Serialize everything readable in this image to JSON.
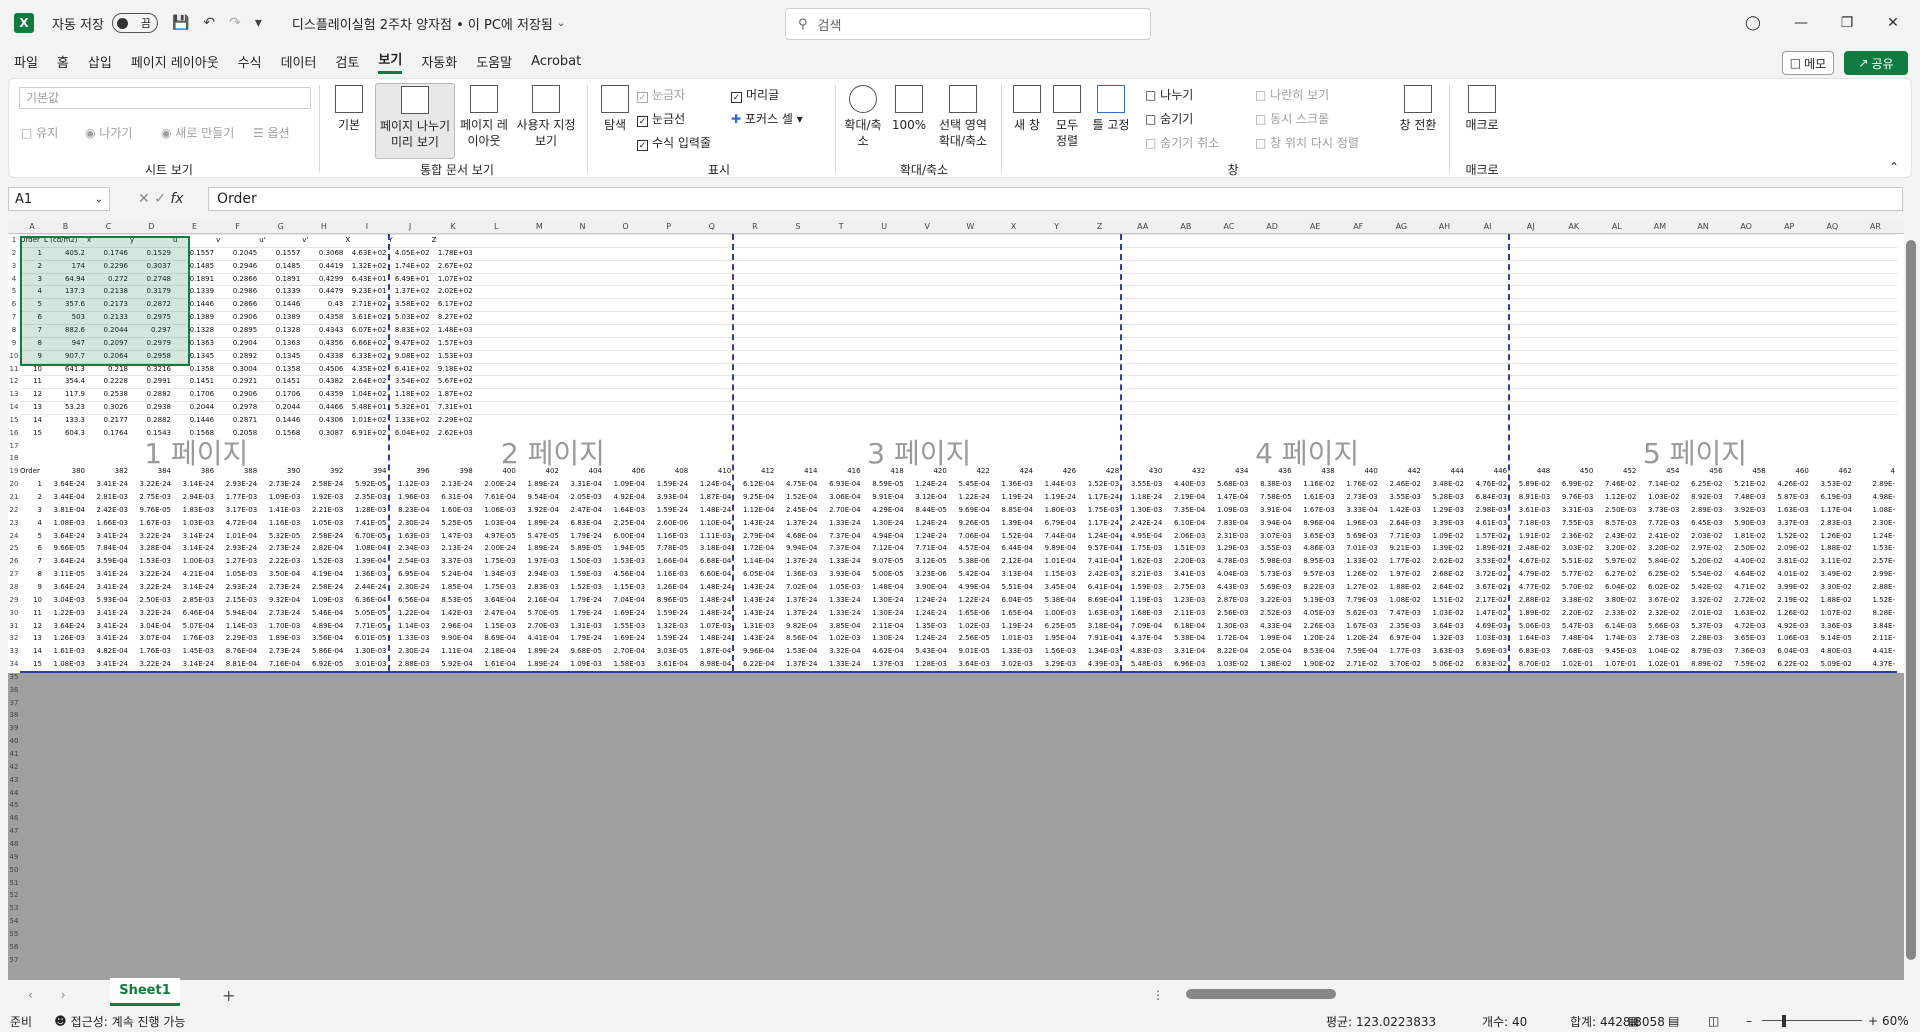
{
  "titlebar": {
    "autosave_label": "자동 저장",
    "autosave_state": "끔",
    "document_title": "디스플레이실험 2주차 양자점 • 이 PC에 저장됨",
    "search_placeholder": "검색"
  },
  "menu": [
    "파일",
    "홈",
    "삽입",
    "페이지 레이아웃",
    "수식",
    "데이터",
    "검토",
    "보기",
    "자동화",
    "도움말",
    "Acrobat"
  ],
  "menu_active": "보기",
  "memo_label": "메모",
  "share_label": "공유",
  "ribbon": {
    "sheet_view": {
      "label": "시트 보기",
      "default_box": "기본값",
      "keep": "유지",
      "exit": "나가기",
      "new": "새로 만들기",
      "options": "옵션"
    },
    "workbook_views": {
      "label": "통합 문서 보기",
      "normal": "기본",
      "page_break": "페이지 나누기 미리 보기",
      "page_layout": "페이지 레이아웃",
      "custom": "사용자 지정 보기"
    },
    "show": {
      "label": "표시",
      "navigation": "탐색",
      "ruler": "눈금자",
      "gridlines": "눈금선",
      "formula_bar": "수식 입력줄",
      "headings": "머리글",
      "focus_cell": "포커스 셀"
    },
    "zoom": {
      "label": "확대/축소",
      "zoom": "확대/축소",
      "hundred": "100%",
      "zoom_selection": "선택 영역 확대/축소"
    },
    "window": {
      "label": "창",
      "new_window": "새 창",
      "arrange_all": "모두 정렬",
      "freeze_panes": "틀 고정",
      "split": "나누기",
      "hide": "숨기기",
      "unhide": "숨기기 취소",
      "side_by_side": "나란히 보기",
      "sync_scroll": "동시 스크롤",
      "reset_position": "창 위치 다시 정렬",
      "switch_windows": "창 전환"
    },
    "macros": {
      "label": "매크로",
      "macros": "매크로"
    }
  },
  "formula_bar": {
    "name_box": "A1",
    "formula": "Order"
  },
  "grid": {
    "columns": [
      "A",
      "B",
      "C",
      "D",
      "E",
      "F",
      "G",
      "H",
      "I",
      "J",
      "K",
      "L",
      "M",
      "N",
      "O",
      "P",
      "Q",
      "R",
      "S",
      "T",
      "U",
      "V",
      "W",
      "X",
      "Y",
      "Z",
      "AA",
      "AB",
      "AC",
      "AD",
      "AE",
      "AF",
      "AG",
      "AH",
      "AI",
      "AJ",
      "AK",
      "AL",
      "AM",
      "AN",
      "AO",
      "AP",
      "AQ",
      "AR"
    ],
    "header_row": [
      "Order",
      "L (cd/m2)",
      "x",
      "y",
      "u",
      "v",
      "u'",
      "v'",
      "X",
      "Y",
      "Z"
    ],
    "data_rows": [
      [
        "1",
        "405.2",
        "0.1746",
        "0.1529",
        "0.1557",
        "0.2045",
        "0.1557",
        "0.3068",
        "4.63E+02",
        "4.05E+02",
        "1.78E+03"
      ],
      [
        "2",
        "174",
        "0.2296",
        "0.3037",
        "0.1485",
        "0.2946",
        "0.1485",
        "0.4419",
        "1.32E+02",
        "1.74E+02",
        "2.67E+02"
      ],
      [
        "3",
        "64.94",
        "0.272",
        "0.2748",
        "0.1891",
        "0.2866",
        "0.1891",
        "0.4299",
        "6.43E+01",
        "6.49E+01",
        "1.07E+02"
      ],
      [
        "4",
        "137.3",
        "0.2138",
        "0.3179",
        "0.1339",
        "0.2986",
        "0.1339",
        "0.4479",
        "9.23E+01",
        "1.37E+02",
        "2.02E+02"
      ],
      [
        "5",
        "357.6",
        "0.2173",
        "0.2872",
        "0.1446",
        "0.2866",
        "0.1446",
        "0.43",
        "2.71E+02",
        "3.58E+02",
        "6.17E+02"
      ],
      [
        "6",
        "503",
        "0.2133",
        "0.2975",
        "0.1389",
        "0.2906",
        "0.1389",
        "0.4358",
        "3.61E+02",
        "5.03E+02",
        "8.27E+02"
      ],
      [
        "7",
        "882.6",
        "0.2044",
        "0.297",
        "0.1328",
        "0.2895",
        "0.1328",
        "0.4343",
        "6.07E+02",
        "8.83E+02",
        "1.48E+03"
      ],
      [
        "8",
        "947",
        "0.2097",
        "0.2979",
        "0.1363",
        "0.2904",
        "0.1363",
        "0.4356",
        "6.66E+02",
        "9.47E+02",
        "1.57E+03"
      ],
      [
        "9",
        "907.7",
        "0.2064",
        "0.2958",
        "0.1345",
        "0.2892",
        "0.1345",
        "0.4338",
        "6.33E+02",
        "9.08E+02",
        "1.53E+03"
      ],
      [
        "10",
        "641.3",
        "0.218",
        "0.3216",
        "0.1358",
        "0.3004",
        "0.1358",
        "0.4506",
        "4.35E+02",
        "6.41E+02",
        "9.18E+02"
      ],
      [
        "11",
        "354.4",
        "0.2228",
        "0.2991",
        "0.1451",
        "0.2921",
        "0.1451",
        "0.4382",
        "2.64E+02",
        "3.54E+02",
        "5.67E+02"
      ],
      [
        "12",
        "117.9",
        "0.2538",
        "0.2882",
        "0.1706",
        "0.2906",
        "0.1706",
        "0.4359",
        "1.04E+02",
        "1.18E+02",
        "1.87E+02"
      ],
      [
        "13",
        "53.23",
        "0.3026",
        "0.2938",
        "0.2044",
        "0.2978",
        "0.2044",
        "0.4466",
        "5.48E+01",
        "5.32E+01",
        "7.31E+01"
      ],
      [
        "14",
        "133.3",
        "0.2177",
        "0.2882",
        "0.1446",
        "0.2871",
        "0.1446",
        "0.4306",
        "1.01E+02",
        "1.33E+02",
        "2.29E+02"
      ],
      [
        "15",
        "604.3",
        "0.1764",
        "0.1543",
        "0.1568",
        "0.2058",
        "0.1568",
        "0.3087",
        "6.91E+02",
        "6.04E+02",
        "2.62E+03"
      ]
    ],
    "spectrum_header_label": "Order",
    "wavelengths": [
      "380",
      "382",
      "384",
      "386",
      "388",
      "390",
      "392",
      "394",
      "396",
      "398",
      "400",
      "402",
      "404",
      "406",
      "408",
      "410",
      "412",
      "414",
      "416",
      "418",
      "420",
      "422",
      "424",
      "426",
      "428",
      "430",
      "432",
      "434",
      "436",
      "438",
      "440",
      "442",
      "444",
      "446",
      "448",
      "450",
      "452",
      "454",
      "456",
      "458",
      "460",
      "462",
      "4"
    ],
    "spectrum_rows": [
      [
        "1",
        "3.64E-24",
        "3.41E-24",
        "3.22E-24",
        "3.14E-24",
        "2.93E-24",
        "2.73E-24",
        "2.58E-24",
        "5.92E-05",
        "1.12E-03",
        "2.13E-24",
        "2.00E-24",
        "1.89E-24",
        "3.31E-04",
        "1.09E-04",
        "1.59E-24",
        "1.24E-04",
        "6.12E-04",
        "4.75E-04",
        "6.93E-04",
        "8.59E-05",
        "1.24E-24",
        "5.45E-04",
        "1.36E-03",
        "1.44E-03",
        "1.52E-03",
        "3.55E-03",
        "4.40E-03",
        "5.68E-03",
        "8.38E-03",
        "1.16E-02",
        "1.76E-02",
        "2.46E-02",
        "3.48E-02",
        "4.76E-02",
        "5.89E-02",
        "6.99E-02",
        "7.46E-02",
        "7.14E-02",
        "6.25E-02",
        "5.21E-02",
        "4.26E-02",
        "3.53E-02",
        "2.89E-"
      ],
      [
        "2",
        "3.44E-04",
        "2.81E-03",
        "2.75E-03",
        "2.94E-03",
        "1.77E-03",
        "1.09E-03",
        "1.92E-03",
        "2.35E-03",
        "1.96E-03",
        "6.31E-04",
        "7.61E-04",
        "9.54E-04",
        "2.05E-03",
        "4.92E-04",
        "3.93E-04",
        "1.87E-04",
        "9.25E-04",
        "1.52E-04",
        "3.06E-04",
        "9.91E-04",
        "3.12E-04",
        "1.22E-24",
        "1.19E-24",
        "1.19E-24",
        "1.17E-24",
        "1.18E-24",
        "2.19E-04",
        "1.47E-04",
        "7.58E-05",
        "1.61E-03",
        "2.73E-03",
        "3.55E-03",
        "5.28E-03",
        "6.84E-03",
        "8.91E-03",
        "9.76E-03",
        "1.12E-02",
        "1.03E-02",
        "8.92E-03",
        "7.48E-03",
        "5.87E-03",
        "6.19E-03",
        "4.98E-"
      ],
      [
        "3",
        "3.81E-04",
        "2.42E-03",
        "9.76E-05",
        "1.83E-03",
        "3.17E-03",
        "1.41E-03",
        "2.21E-03",
        "1.28E-03",
        "8.23E-04",
        "1.60E-03",
        "1.06E-03",
        "3.92E-04",
        "2.47E-04",
        "1.64E-03",
        "1.59E-24",
        "1.48E-24",
        "1.12E-04",
        "2.45E-04",
        "2.70E-04",
        "4.29E-04",
        "8.44E-05",
        "9.69E-04",
        "8.85E-04",
        "1.80E-03",
        "1.75E-03",
        "1.30E-03",
        "7.35E-04",
        "1.09E-03",
        "3.91E-04",
        "1.67E-03",
        "3.33E-04",
        "1.42E-03",
        "1.29E-03",
        "2.98E-03",
        "3.61E-03",
        "3.31E-03",
        "2.50E-03",
        "3.73E-03",
        "2.89E-03",
        "3.92E-03",
        "1.63E-03",
        "1.17E-04",
        "1.08E-"
      ],
      [
        "4",
        "1.08E-03",
        "1.66E-03",
        "1.67E-03",
        "1.03E-03",
        "4.72E-04",
        "1.16E-03",
        "1.05E-03",
        "7.41E-05",
        "2.30E-24",
        "5.25E-05",
        "1.03E-04",
        "1.89E-24",
        "6.83E-04",
        "2.25E-04",
        "2.60E-06",
        "1.10E-04",
        "1.43E-24",
        "1.37E-24",
        "1.33E-24",
        "1.30E-24",
        "1.24E-24",
        "9.26E-05",
        "1.39E-04",
        "6.79E-04",
        "1.17E-24",
        "2.42E-24",
        "6.10E-04",
        "7.83E-04",
        "3.94E-04",
        "8.96E-04",
        "1.96E-03",
        "2.64E-03",
        "3.39E-03",
        "4.61E-03",
        "7.18E-03",
        "7.55E-03",
        "8.57E-03",
        "7.72E-03",
        "6.45E-03",
        "5.90E-03",
        "3.37E-03",
        "2.83E-03",
        "2.30E-"
      ],
      [
        "5",
        "3.64E-24",
        "3.41E-24",
        "3.22E-24",
        "3.14E-24",
        "1.01E-04",
        "5.32E-05",
        "2.58E-24",
        "6.70E-05",
        "1.63E-03",
        "1.47E-03",
        "4.97E-05",
        "5.47E-05",
        "1.79E-24",
        "6.00E-04",
        "1.16E-03",
        "1.11E-03",
        "2.79E-04",
        "4.68E-04",
        "7.37E-04",
        "4.94E-04",
        "1.24E-24",
        "7.06E-04",
        "1.52E-04",
        "7.44E-04",
        "1.24E-04",
        "4.95E-04",
        "2.06E-03",
        "2.31E-03",
        "3.07E-03",
        "3.65E-03",
        "5.69E-03",
        "7.71E-03",
        "1.09E-02",
        "1.57E-02",
        "1.91E-02",
        "2.36E-02",
        "2.43E-02",
        "2.41E-02",
        "2.03E-02",
        "1.81E-02",
        "1.52E-02",
        "1.26E-02",
        "1.24E-"
      ],
      [
        "6",
        "9.66E-05",
        "7.84E-04",
        "3.28E-04",
        "3.14E-24",
        "2.93E-24",
        "2.73E-24",
        "2.82E-04",
        "1.08E-04",
        "2.34E-03",
        "2.13E-24",
        "2.00E-24",
        "1.89E-24",
        "5.89E-05",
        "1.94E-05",
        "7.78E-05",
        "3.18E-04",
        "1.72E-04",
        "9.94E-04",
        "7.37E-04",
        "7.12E-04",
        "7.71E-04",
        "4.57E-04",
        "6.44E-04",
        "9.89E-04",
        "9.57E-04",
        "1.75E-03",
        "1.51E-03",
        "1.29E-03",
        "3.55E-03",
        "4.86E-03",
        "7.01E-03",
        "9.21E-03",
        "1.39E-02",
        "1.89E-02",
        "2.48E-02",
        "3.03E-02",
        "3.20E-02",
        "3.20E-02",
        "2.97E-02",
        "2.50E-02",
        "2.09E-02",
        "1.88E-02",
        "1.53E-"
      ],
      [
        "7",
        "3.64E-24",
        "3.59E-04",
        "1.53E-03",
        "1.00E-03",
        "1.27E-03",
        "2.22E-03",
        "1.52E-03",
        "1.39E-04",
        "2.54E-03",
        "3.37E-03",
        "1.75E-03",
        "1.97E-03",
        "1.50E-03",
        "1.53E-03",
        "1.66E-04",
        "6.68E-04",
        "1.14E-04",
        "1.37E-24",
        "1.33E-24",
        "9.07E-05",
        "3.12E-05",
        "5.38E-06",
        "2.12E-04",
        "1.01E-04",
        "7.41E-04",
        "1.62E-03",
        "2.20E-03",
        "4.78E-03",
        "5.98E-03",
        "8.95E-03",
        "1.33E-02",
        "1.77E-02",
        "2.62E-02",
        "3.53E-02",
        "4.67E-02",
        "5.51E-02",
        "5.97E-02",
        "5.84E-02",
        "5.20E-02",
        "4.40E-02",
        "3.81E-02",
        "3.11E-02",
        "2.57E-"
      ],
      [
        "8",
        "3.11E-05",
        "3.41E-24",
        "3.22E-24",
        "4.21E-04",
        "1.05E-03",
        "3.50E-04",
        "4.19E-04",
        "1.36E-03",
        "6.95E-04",
        "5.24E-04",
        "1.34E-03",
        "2.94E-03",
        "1.59E-03",
        "4.56E-04",
        "1.16E-03",
        "6.60E-04",
        "6.05E-04",
        "1.36E-03",
        "3.93E-04",
        "5.00E-05",
        "3.23E-06",
        "5.42E-04",
        "3.13E-04",
        "1.15E-03",
        "2.42E-03",
        "3.21E-03",
        "3.41E-03",
        "4.04E-03",
        "5.73E-03",
        "9.57E-03",
        "1.26E-02",
        "1.97E-02",
        "2.68E-02",
        "3.72E-02",
        "4.79E-02",
        "5.77E-02",
        "6.27E-02",
        "6.25E-02",
        "5.54E-02",
        "4.64E-02",
        "4.01E-02",
        "3.49E-02",
        "2.99E-"
      ],
      [
        "9",
        "3.64E-24",
        "3.41E-24",
        "3.22E-24",
        "3.14E-24",
        "2.93E-24",
        "2.73E-24",
        "2.58E-24",
        "2.44E-24",
        "2.30E-24",
        "1.85E-04",
        "1.75E-03",
        "2.83E-03",
        "1.52E-03",
        "1.15E-03",
        "1.26E-04",
        "1.48E-24",
        "1.43E-24",
        "7.02E-04",
        "1.05E-03",
        "1.48E-04",
        "3.90E-04",
        "4.99E-04",
        "5.51E-04",
        "3.45E-04",
        "6.41E-04",
        "1.59E-03",
        "2.75E-03",
        "4.43E-03",
        "5.69E-03",
        "8.22E-03",
        "1.27E-02",
        "1.88E-02",
        "2.64E-02",
        "3.67E-02",
        "4.77E-02",
        "5.70E-02",
        "6.04E-02",
        "6.02E-02",
        "5.42E-02",
        "4.71E-02",
        "3.99E-02",
        "3.30E-02",
        "2.88E-"
      ],
      [
        "10",
        "3.04E-03",
        "5.93E-04",
        "2.50E-03",
        "2.85E-03",
        "2.15E-03",
        "9.32E-04",
        "1.09E-03",
        "6.36E-04",
        "6.56E-04",
        "8.53E-05",
        "3.64E-04",
        "2.16E-04",
        "1.79E-24",
        "7.04E-04",
        "8.96E-05",
        "1.48E-24",
        "1.43E-24",
        "1.37E-24",
        "1.33E-24",
        "1.30E-24",
        "1.24E-24",
        "1.22E-24",
        "6.04E-05",
        "5.38E-04",
        "8.69E-04",
        "1.19E-03",
        "1.23E-03",
        "2.87E-03",
        "3.22E-03",
        "5.19E-03",
        "7.79E-03",
        "1.08E-02",
        "1.51E-02",
        "2.17E-02",
        "2.88E-02",
        "3.38E-02",
        "3.80E-02",
        "3.67E-02",
        "3.32E-02",
        "2.72E-02",
        "2.19E-02",
        "1.88E-02",
        "1.52E-"
      ],
      [
        "11",
        "1.22E-03",
        "3.41E-24",
        "3.22E-24",
        "6.46E-04",
        "5.94E-04",
        "2.73E-24",
        "5.46E-04",
        "5.05E-05",
        "1.22E-04",
        "1.42E-03",
        "2.47E-04",
        "5.70E-05",
        "1.79E-24",
        "1.69E-24",
        "1.59E-24",
        "1.48E-24",
        "1.43E-24",
        "1.37E-24",
        "1.33E-24",
        "1.30E-24",
        "1.24E-24",
        "1.65E-06",
        "1.65E-04",
        "1.00E-03",
        "1.63E-03",
        "1.68E-03",
        "2.11E-03",
        "2.56E-03",
        "2.52E-03",
        "4.05E-03",
        "5.62E-03",
        "7.47E-03",
        "1.03E-02",
        "1.47E-02",
        "1.89E-02",
        "2.20E-02",
        "2.33E-02",
        "2.32E-02",
        "2.01E-02",
        "1.63E-02",
        "1.26E-02",
        "1.07E-02",
        "8.28E-"
      ],
      [
        "12",
        "3.64E-24",
        "3.41E-24",
        "3.04E-04",
        "5.07E-04",
        "1.14E-03",
        "1.70E-03",
        "4.89E-04",
        "7.71E-05",
        "1.14E-03",
        "2.96E-04",
        "1.15E-03",
        "2.70E-03",
        "1.31E-03",
        "1.55E-03",
        "1.32E-03",
        "1.07E-03",
        "1.31E-03",
        "9.82E-04",
        "3.85E-04",
        "2.11E-04",
        "1.35E-03",
        "1.02E-03",
        "1.19E-24",
        "6.25E-05",
        "3.18E-04",
        "7.09E-04",
        "6.18E-04",
        "1.30E-03",
        "4.33E-04",
        "2.26E-03",
        "1.67E-03",
        "2.35E-03",
        "3.64E-03",
        "4.69E-03",
        "5.06E-03",
        "5.47E-03",
        "6.14E-03",
        "5.66E-03",
        "5.37E-03",
        "4.72E-03",
        "4.92E-03",
        "3.36E-03",
        "3.84E-"
      ],
      [
        "13",
        "1.26E-03",
        "3.41E-24",
        "3.07E-04",
        "1.76E-03",
        "2.29E-03",
        "1.89E-03",
        "3.56E-04",
        "6.01E-05",
        "1.33E-03",
        "9.90E-04",
        "8.69E-04",
        "4.41E-04",
        "1.79E-24",
        "1.69E-24",
        "1.59E-24",
        "1.48E-24",
        "1.43E-24",
        "8.56E-04",
        "1.02E-03",
        "1.30E-24",
        "1.24E-24",
        "2.56E-05",
        "1.01E-03",
        "1.95E-04",
        "7.91E-04",
        "4.37E-04",
        "5.38E-04",
        "1.72E-04",
        "1.99E-04",
        "1.20E-24",
        "1.20E-24",
        "6.97E-04",
        "1.32E-03",
        "1.03E-03",
        "1.64E-03",
        "7.48E-04",
        "1.74E-03",
        "2.73E-03",
        "2.28E-03",
        "3.65E-03",
        "1.06E-03",
        "9.14E-05",
        "2.11E-"
      ],
      [
        "14",
        "1.61E-03",
        "4.82E-04",
        "1.76E-03",
        "1.45E-03",
        "8.76E-04",
        "2.73E-24",
        "5.86E-04",
        "1.30E-03",
        "2.30E-24",
        "1.11E-04",
        "2.18E-04",
        "1.89E-24",
        "9.68E-05",
        "2.70E-04",
        "3.03E-05",
        "1.87E-04",
        "9.96E-04",
        "1.53E-04",
        "3.32E-04",
        "4.62E-04",
        "5.43E-04",
        "9.01E-05",
        "1.33E-03",
        "1.56E-03",
        "1.34E-03",
        "4.83E-03",
        "3.31E-04",
        "8.22E-04",
        "2.05E-04",
        "8.53E-04",
        "7.59E-04",
        "1.77E-03",
        "3.63E-03",
        "5.69E-03",
        "6.83E-03",
        "7.68E-03",
        "9.45E-03",
        "1.04E-02",
        "8.79E-03",
        "7.36E-03",
        "6.04E-03",
        "4.80E-03",
        "4.41E-"
      ],
      [
        "15",
        "1.08E-03",
        "3.41E-24",
        "3.22E-24",
        "3.14E-24",
        "8.81E-04",
        "7.16E-04",
        "6.92E-05",
        "3.01E-03",
        "2.88E-03",
        "5.92E-04",
        "1.61E-04",
        "1.89E-24",
        "1.09E-03",
        "1.58E-03",
        "3.61E-04",
        "8.98E-04",
        "6.22E-04",
        "1.37E-24",
        "1.33E-24",
        "1.37E-03",
        "1.28E-03",
        "3.64E-03",
        "3.02E-03",
        "3.29E-03",
        "4.39E-03",
        "5.48E-03",
        "6.96E-03",
        "1.03E-02",
        "1.38E-02",
        "1.90E-02",
        "2.71E-02",
        "3.70E-02",
        "5.06E-02",
        "6.83E-02",
        "8.70E-02",
        "1.02E-01",
        "1.07E-01",
        "1.02E-01",
        "8.89E-02",
        "7.59E-02",
        "6.22E-02",
        "5.09E-02",
        "4.37E-"
      ]
    ],
    "page_labels": [
      "1 페이지",
      "2 페이지",
      "3 페이지",
      "4 페이지",
      "5 페이지"
    ]
  },
  "sheet_tab": "Sheet1",
  "status": {
    "ready": "준비",
    "accessibility": "접근성: 계속 진행 가능",
    "average": "평균: 123.0223833",
    "count": "개수: 40",
    "sum": "합계: 4428.8058",
    "zoom": "60%"
  }
}
